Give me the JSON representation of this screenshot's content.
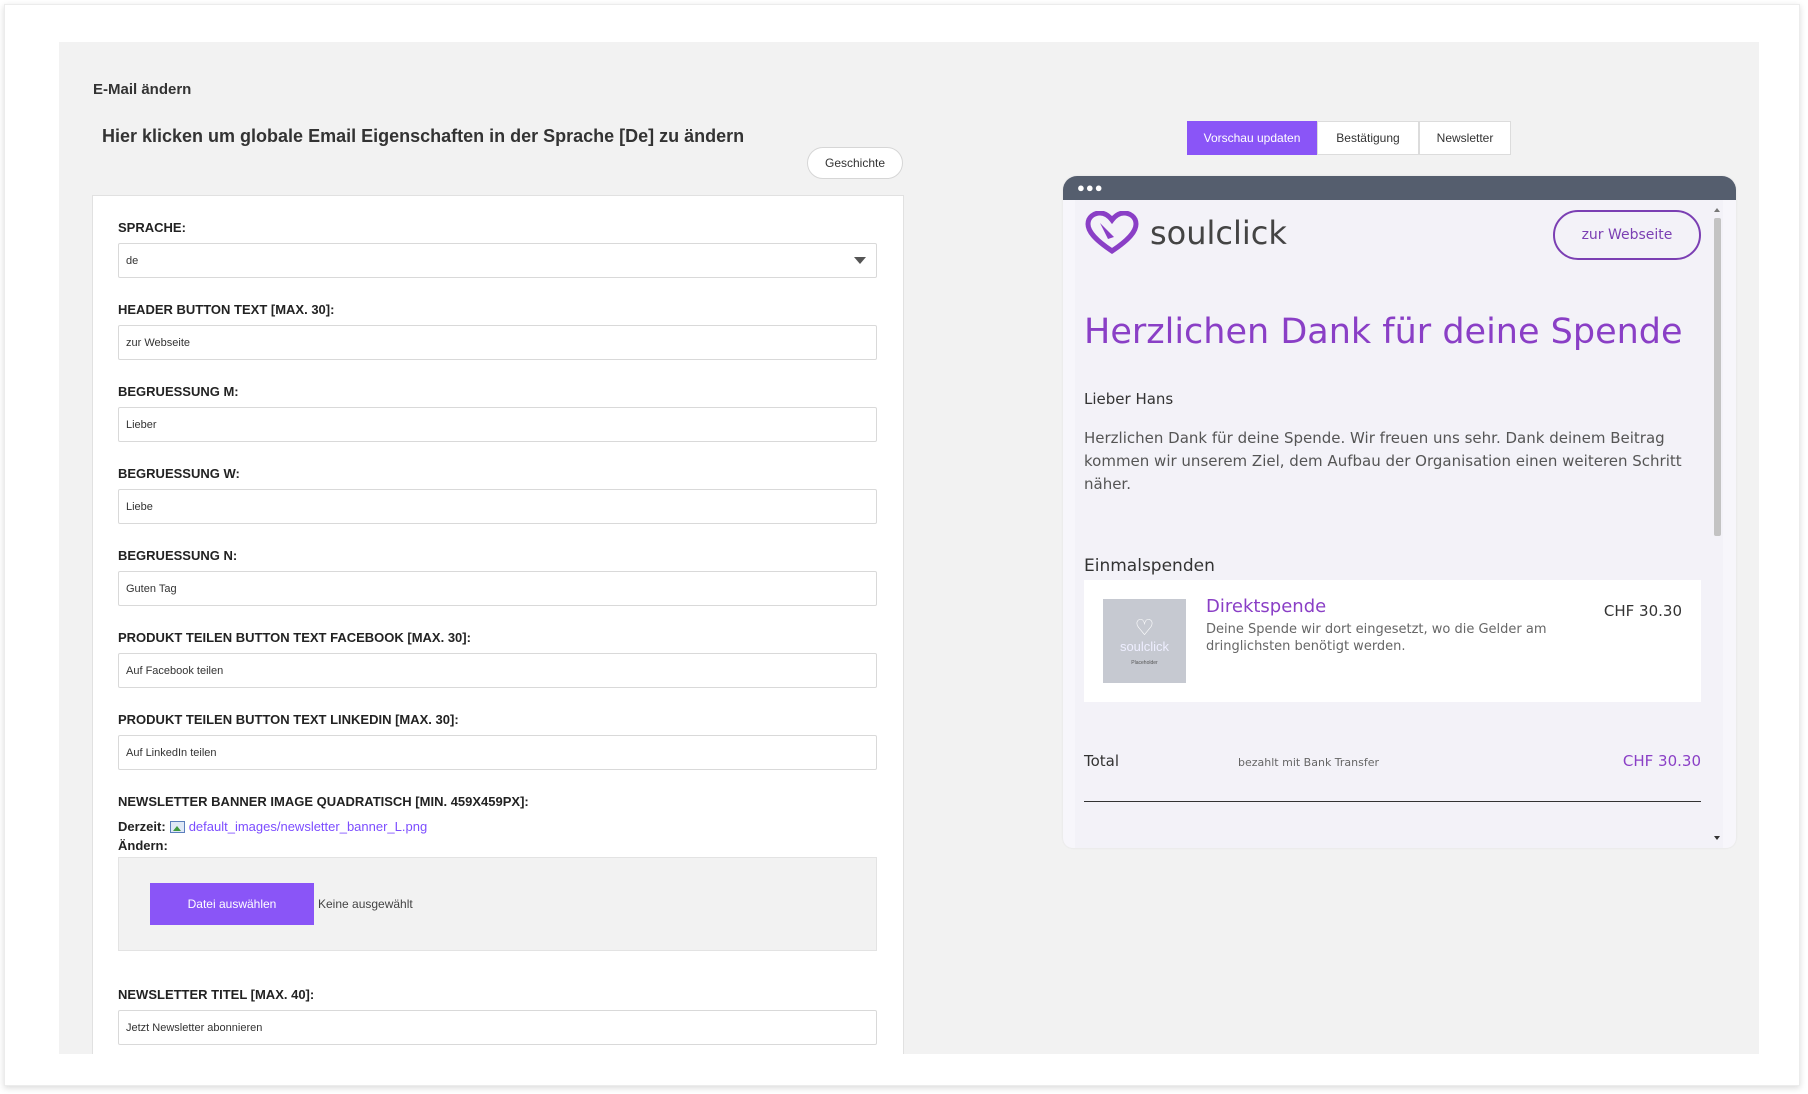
{
  "page": {
    "title": "E-Mail ändern",
    "global_link": "Hier klicken um globale Email Eigenschaften in der Sprache [De] zu ändern",
    "history_button": "Geschichte"
  },
  "form": {
    "language": {
      "label": "SPRACHE:",
      "value": "de"
    },
    "header_button": {
      "label": "HEADER BUTTON TEXT [MAX. 30]:",
      "value": "zur Webseite"
    },
    "greeting_m": {
      "label": "BEGRUESSUNG M:",
      "value": "Lieber"
    },
    "greeting_w": {
      "label": "BEGRUESSUNG W:",
      "value": "Liebe"
    },
    "greeting_n": {
      "label": "BEGRUESSUNG N:",
      "value": "Guten Tag"
    },
    "share_facebook": {
      "label": "PRODUKT TEILEN BUTTON TEXT FACEBOOK [MAX. 30]:",
      "value": "Auf Facebook teilen"
    },
    "share_linkedin": {
      "label": "PRODUKT TEILEN BUTTON TEXT LINKEDIN [MAX. 30]:",
      "value": "Auf LinkedIn teilen"
    },
    "banner": {
      "label": "NEWSLETTER BANNER IMAGE QUADRATISCH [MIN. 459X459PX]:",
      "current_label": "Derzeit:",
      "current_file": "default_images/newsletter_banner_L.png",
      "change_label": "Ändern:",
      "choose_button": "Datei auswählen",
      "no_file": "Keine ausgewählt"
    },
    "newsletter_title": {
      "label": "NEWSLETTER TITEL [MAX. 40]:",
      "value": "Jetzt Newsletter abonnieren"
    }
  },
  "tabs": [
    {
      "label": "Vorschau updaten",
      "active": true
    },
    {
      "label": "Bestätigung",
      "active": false
    },
    {
      "label": "Newsletter",
      "active": false
    }
  ],
  "preview": {
    "window_dots": "●●●",
    "brand": "soulclick",
    "header_button": "zur Webseite",
    "title": "Herzlichen Dank für deine Spende",
    "greeting": "Lieber Hans",
    "body": "Herzlichen Dank für deine Spende. Wir freuen uns sehr. Dank deinem Beitrag kommen wir unserem Ziel, dem Aufbau der Organisation einen weiteren Schritt näher.",
    "section_title": "Einmalspenden",
    "item": {
      "name": "Direktspende",
      "description": "Deine Spende wir dort eingesetzt, wo die Gelder am dringlichsten benötigt werden.",
      "price": "CHF 30.30",
      "image_brand": "soulclick",
      "image_caption": "Placeholder"
    },
    "total_label": "Total",
    "payment_method": "bezahlt mit Bank Transfer",
    "total_amount": "CHF 30.30"
  },
  "colors": {
    "accent": "#8a55f7",
    "brand_purple": "#8a3fc6",
    "canvas_bg": "#f2f2f2"
  }
}
